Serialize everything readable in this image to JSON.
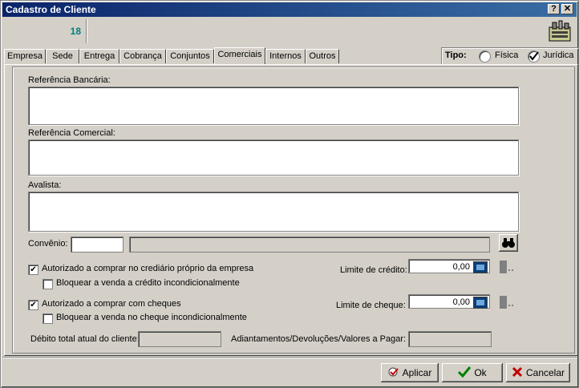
{
  "window": {
    "title": "Cadastro de Cliente",
    "help_btn": "?",
    "close_btn": "✕"
  },
  "header": {
    "id": "18"
  },
  "tabs": [
    {
      "label": "Empresa"
    },
    {
      "label": "Sede"
    },
    {
      "label": "Entrega"
    },
    {
      "label": "Cobrança"
    },
    {
      "label": "Conjuntos"
    },
    {
      "label": "Comerciais"
    },
    {
      "label": "Internos"
    },
    {
      "label": "Outros"
    }
  ],
  "tipo": {
    "label": "Tipo:",
    "fisica": "Física",
    "juridica": "Jurídica",
    "selected": "Jurídica"
  },
  "form": {
    "ref_bancaria_label": "Referência Bancária:",
    "ref_comercial_label": "Referência Comercial:",
    "avalista_label": "Avalista:",
    "convenio_label": "Convênio:",
    "autorizado_crediario": "Autorizado a comprar no crediário próprio da empresa",
    "bloquear_credito": "Bloquear a venda a crédito incondicionalmente",
    "autorizado_cheques": "Autorizado a comprar com cheques",
    "bloquear_cheque": "Bloquear a venda no cheque incondicionalmente",
    "limite_credito_label": "Limite de crédito:",
    "limite_credito_value": "0,00",
    "limite_cheque_label": "Limite de cheque:",
    "limite_cheque_value": "0,00",
    "debito_label": "Débito total atual do cliente:",
    "adiantamentos_label": "Adiantamentos/Devoluções/Valores a Pagar:",
    "checks": {
      "autorizado_crediario": true,
      "bloquear_credito": false,
      "autorizado_cheques": true,
      "bloquear_cheque": false
    }
  },
  "footer": {
    "aplicar": "Aplicar",
    "ok": "Ok",
    "cancelar": "Cancelar"
  }
}
